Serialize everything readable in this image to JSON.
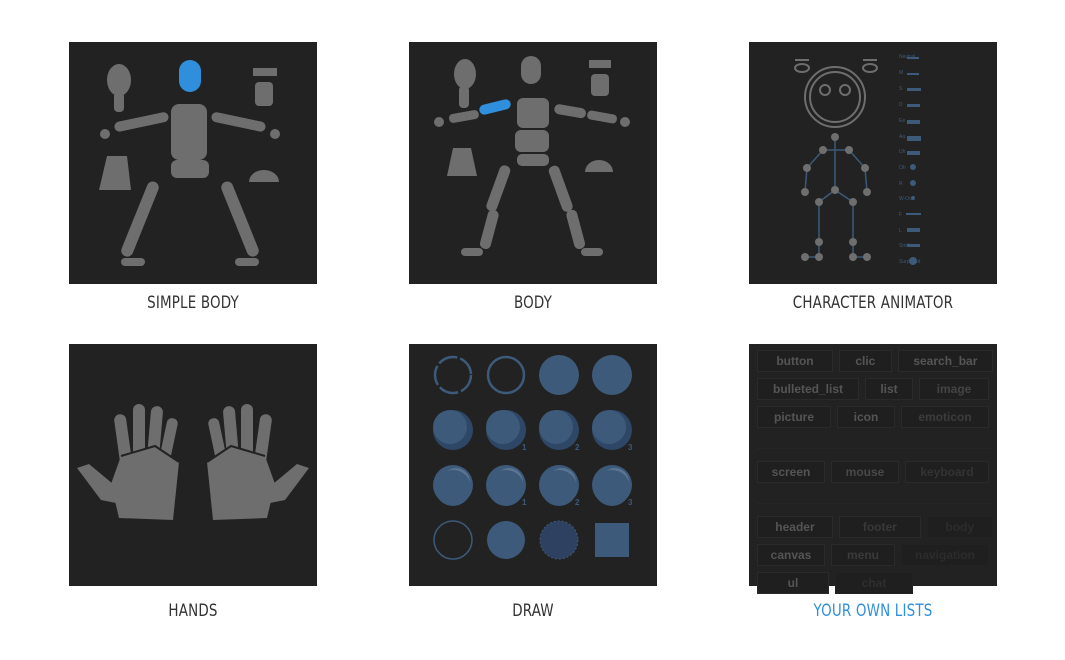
{
  "cards": [
    {
      "label": "SIMPLE BODY"
    },
    {
      "label": "BODY"
    },
    {
      "label": "CHARACTER ANIMATOR",
      "mouths": [
        "Neutral",
        "M",
        "S",
        "D",
        "Ee",
        "Aa",
        "Uh",
        "Oh",
        "R",
        "W-Oo",
        "F",
        "L",
        "Smile",
        "Surprised"
      ]
    },
    {
      "label": "HANDS"
    },
    {
      "label": "DRAW",
      "numbers": [
        "1",
        "2",
        "3",
        "1",
        "2",
        "3"
      ]
    },
    {
      "label": "YOUR OWN LISTS",
      "active": true,
      "tags": [
        [
          "button",
          "clic",
          "search_bar"
        ],
        [
          "bulleted_list",
          "list",
          "image"
        ],
        [
          "picture",
          "icon",
          "emoticon"
        ],
        [
          "screen",
          "mouse",
          "keyboard"
        ],
        [
          "header",
          "footer",
          "body"
        ],
        [
          "canvas",
          "menu",
          "navigation"
        ],
        [
          "ul",
          "chat"
        ]
      ]
    }
  ],
  "colors": {
    "card_bg": "#222222",
    "highlight": "#2f8fdd",
    "shape": "#6e6e6e",
    "draw": "#3d5a7a"
  }
}
